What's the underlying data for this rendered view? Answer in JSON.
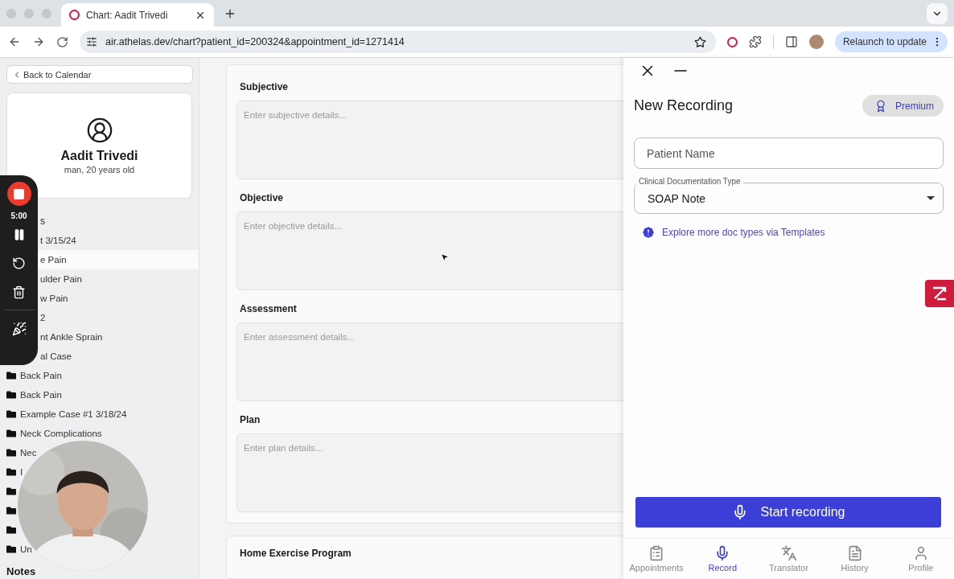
{
  "browser": {
    "tab": {
      "title": "Chart: Aadit Trivedi"
    },
    "url": "air.athelas.dev/chart?patient_id=200324&appointment_id=1271414",
    "relaunch": "Relaunch to update"
  },
  "sidebar": {
    "back": "Back to Calendar",
    "patient": {
      "name": "Aadit Trivedi",
      "details": "man, 20 years old"
    },
    "section_heading": "s",
    "cases": [
      {
        "kind": "partial",
        "label": "t 3/15/24",
        "selected": false
      },
      {
        "kind": "partial",
        "label": "e Pain",
        "selected": true
      },
      {
        "kind": "partial",
        "label": "ulder Pain",
        "selected": false
      },
      {
        "kind": "partial",
        "label": "w Pain",
        "selected": false
      },
      {
        "kind": "partial",
        "label": "2",
        "selected": false
      },
      {
        "kind": "partial",
        "label": "nt Ankle Sprain",
        "selected": false
      },
      {
        "kind": "partial",
        "label": "al Case",
        "selected": false
      },
      {
        "kind": "folder",
        "label": "Back Pain",
        "selected": false
      },
      {
        "kind": "folder",
        "label": "Back Pain",
        "selected": false
      },
      {
        "kind": "folder",
        "label": "Example Case #1 3/18/24",
        "selected": false
      },
      {
        "kind": "folder",
        "label": "Neck Complications",
        "selected": false
      },
      {
        "kind": "folder",
        "label": "Nec",
        "selected": false
      },
      {
        "kind": "folder",
        "label": "I",
        "selected": false
      },
      {
        "kind": "folder_only",
        "selected": false
      },
      {
        "kind": "folder_only",
        "selected": false
      },
      {
        "kind": "folder_only",
        "selected": false
      },
      {
        "kind": "folder",
        "label": "Un",
        "selected": false
      }
    ],
    "notes_heading": "Notes"
  },
  "recorder": {
    "time": "5:00"
  },
  "form": {
    "sections": [
      {
        "title": "Subjective",
        "placeholder": "Enter subjective details..."
      },
      {
        "title": "Objective",
        "placeholder": "Enter objective details..."
      },
      {
        "title": "Assessment",
        "placeholder": "Enter assessment details..."
      },
      {
        "title": "Plan",
        "placeholder": "Enter plan details..."
      }
    ],
    "next_section": "Home Exercise Program"
  },
  "panel": {
    "title": "New Recording",
    "badge": "Premium",
    "patient_field": {
      "placeholder": "Patient Name"
    },
    "doc_type": {
      "label": "Clinical Documentation Type",
      "value": "SOAP Note"
    },
    "templates_link": "Explore more doc types via Templates",
    "start_button": "Start recording",
    "nav": [
      {
        "kind": "appointments",
        "label": "Appointments",
        "selected": false
      },
      {
        "kind": "record",
        "label": "Record",
        "selected": true
      },
      {
        "kind": "translator",
        "label": "Translator",
        "selected": false
      },
      {
        "kind": "history",
        "label": "History",
        "selected": false
      },
      {
        "kind": "profile",
        "label": "Profile",
        "selected": false
      }
    ]
  }
}
